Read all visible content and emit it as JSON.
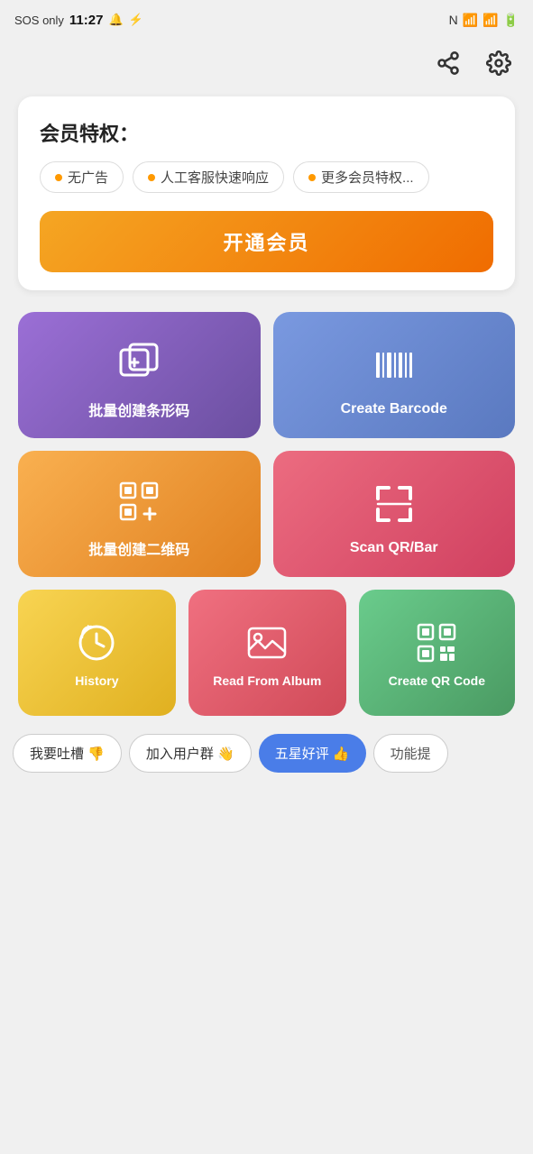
{
  "status": {
    "left_text": "SOS only",
    "time": "11:27",
    "bell_icon": "🔔",
    "lightning_icon": "⚡"
  },
  "toolbar": {
    "share_icon": "share",
    "settings_icon": "settings"
  },
  "membership": {
    "title": "会员特权：",
    "tags": [
      {
        "label": "无广告"
      },
      {
        "label": "人工客服快速响应"
      },
      {
        "label": "更多会员特权..."
      }
    ],
    "cta_label": "开通会员"
  },
  "grid": {
    "row1": [
      {
        "id": "batch-barcode",
        "label": "批量创建条形码",
        "color": "purple"
      },
      {
        "id": "create-barcode",
        "label": "Create Barcode",
        "color": "blue"
      }
    ],
    "row2": [
      {
        "id": "batch-qr",
        "label": "批量创建二维码",
        "color": "orange"
      },
      {
        "id": "scan-qr",
        "label": "Scan QR/Bar",
        "color": "red"
      }
    ],
    "row3": [
      {
        "id": "history",
        "label": "History",
        "color": "yellow"
      },
      {
        "id": "read-album",
        "label": "Read From Album",
        "color": "pink"
      },
      {
        "id": "create-qr",
        "label": "Create QR Code",
        "color": "green"
      }
    ]
  },
  "bottom_bar": {
    "buttons": [
      {
        "id": "feedback",
        "label": "我要吐槽 👎",
        "style": "outline"
      },
      {
        "id": "join-group",
        "label": "加入用户群 👋",
        "style": "outline"
      },
      {
        "id": "five-star",
        "label": "五星好评 👍",
        "style": "blue"
      },
      {
        "id": "suggest",
        "label": "功能提",
        "style": "outline-gray"
      }
    ]
  }
}
